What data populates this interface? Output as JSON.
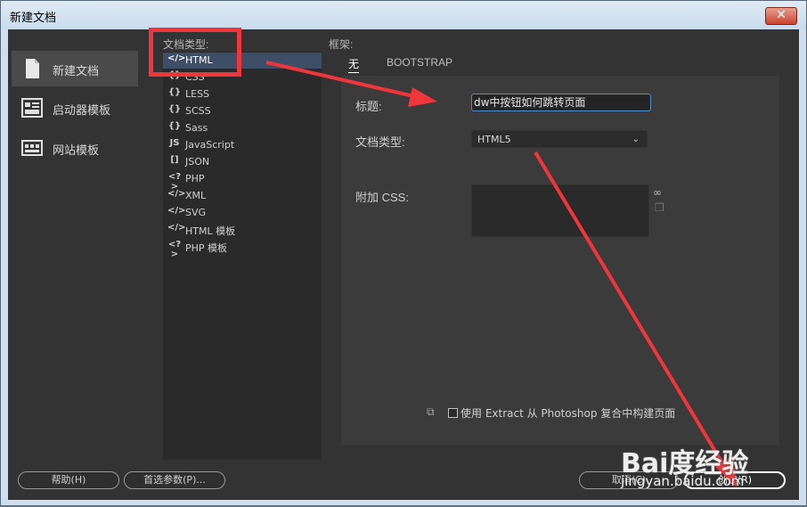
{
  "window": {
    "title": "新建文档",
    "close_glyph": "✕"
  },
  "nav": {
    "items": [
      {
        "label": "新建文档",
        "icon": "document-icon",
        "selected": true
      },
      {
        "label": "启动器模板",
        "icon": "starter-template-icon",
        "selected": false
      },
      {
        "label": "网站模板",
        "icon": "site-template-icon",
        "selected": false
      }
    ]
  },
  "doc_types": {
    "header": "文档类型:",
    "items": [
      {
        "label": "HTML",
        "glyph": "</>",
        "selected": true
      },
      {
        "label": "CSS",
        "glyph": "{}"
      },
      {
        "label": "LESS",
        "glyph": "{}"
      },
      {
        "label": "SCSS",
        "glyph": "{}"
      },
      {
        "label": "Sass",
        "glyph": "{}"
      },
      {
        "label": "JavaScript",
        "glyph": "JS"
      },
      {
        "label": "JSON",
        "glyph": "[]"
      },
      {
        "label": "PHP",
        "glyph": "<?>"
      },
      {
        "label": "XML",
        "glyph": "</>"
      },
      {
        "label": "SVG",
        "glyph": "</>"
      },
      {
        "label": "HTML 模板",
        "glyph": "</>"
      },
      {
        "label": "PHP 模板",
        "glyph": "<?>"
      }
    ]
  },
  "framework": {
    "header": "框架:",
    "tabs": [
      {
        "label": "无",
        "active": true
      },
      {
        "label": "BOOTSTRAP",
        "active": false
      }
    ]
  },
  "form": {
    "title_label": "标题:",
    "title_value": "dw中按钮如何跳转页面",
    "doctype_label": "文档类型:",
    "doctype_value": "HTML5",
    "attach_css_label": "附加 CSS:",
    "link_icon": "link-icon",
    "trash_icon": "trash-icon",
    "photoshop_checkbox_label": "使用 Extract 从 Photoshop 复合中构建页面",
    "photoshop_checked": false
  },
  "footer": {
    "help": "帮助(H)",
    "prefs": "首选参数(P)...",
    "cancel": "取消(C)",
    "create": "创建(R)"
  },
  "watermark": {
    "brand": "Bai度经验",
    "url": "jingyan.baidu.com"
  },
  "colors": {
    "annotation_red": "#f0353b",
    "selection_blue": "#3d4e66",
    "focus_blue": "#4f8fd0"
  }
}
